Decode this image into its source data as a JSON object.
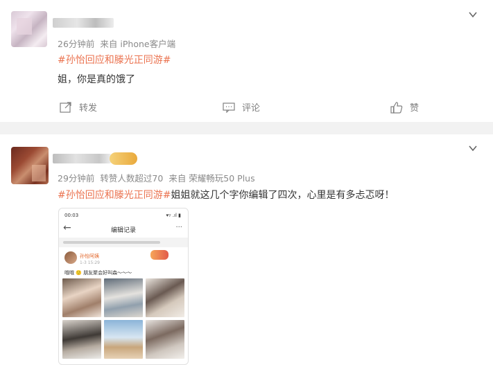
{
  "post1": {
    "meta_time": "26分钟前",
    "meta_source": "来自 iPhone客户端",
    "topic": "#孙怡回应和滕光正同游#",
    "text": "姐，你是真的饿了",
    "actions": {
      "repost_label": "转发",
      "comment_label": "评论",
      "like_label": "赞"
    }
  },
  "post2": {
    "meta_time": "29分钟前",
    "meta_likes": "转赞人数超过70",
    "meta_source": "来自 荣耀畅玩50 Plus",
    "topic": "#孙怡回应和滕光正同游#",
    "text": "姐姐就这几个字你编辑了四次，心里是有多忐忑呀！",
    "screenshot": {
      "status_time": "00:03",
      "status_icons": "▾▿ .ıl ▮",
      "back_icon": "arrow-left-icon",
      "title": "编辑记录",
      "more_icon": "more-icon",
      "author": "孙怡阿姨",
      "post_time": "1-3 15:29",
      "content": "哦哦 🙂 朋友聚会好叫森～～～"
    }
  },
  "colors": {
    "topic": "#eb7350",
    "meta": "#8a8a8a",
    "divider": "#f2f2f2"
  }
}
